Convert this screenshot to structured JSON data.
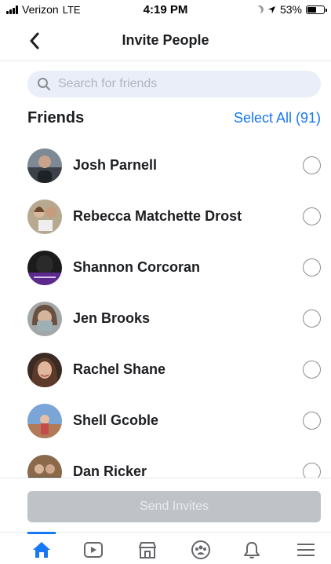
{
  "status_bar": {
    "carrier": "Verizon",
    "network": "LTE",
    "time": "4:19 PM",
    "battery": "53%",
    "battery_level": 0.53
  },
  "header": {
    "title": "Invite People",
    "back_icon": "chevron-left-icon"
  },
  "search": {
    "placeholder": "Search for friends",
    "value": ""
  },
  "section": {
    "title": "Friends",
    "select_all": "Select All (91)"
  },
  "friends": [
    {
      "name": "Josh Parnell",
      "selected": false
    },
    {
      "name": "Rebecca Matchette Drost",
      "selected": false
    },
    {
      "name": "Shannon Corcoran",
      "selected": false
    },
    {
      "name": "Jen Brooks",
      "selected": false
    },
    {
      "name": "Rachel Shane",
      "selected": false
    },
    {
      "name": "Shell Gcoble",
      "selected": false
    },
    {
      "name": "Dan Ricker",
      "selected": false
    }
  ],
  "footer": {
    "send_label": "Send Invites"
  },
  "tabs": [
    {
      "icon": "home-icon",
      "active": true
    },
    {
      "icon": "video-icon",
      "active": false
    },
    {
      "icon": "marketplace-icon",
      "active": false
    },
    {
      "icon": "groups-icon",
      "active": false
    },
    {
      "icon": "bell-icon",
      "active": false
    },
    {
      "icon": "menu-icon",
      "active": false
    }
  ],
  "colors": {
    "accent": "#1877f2",
    "search_bg": "#e9eef8",
    "disabled_button": "#bfc2c7"
  }
}
